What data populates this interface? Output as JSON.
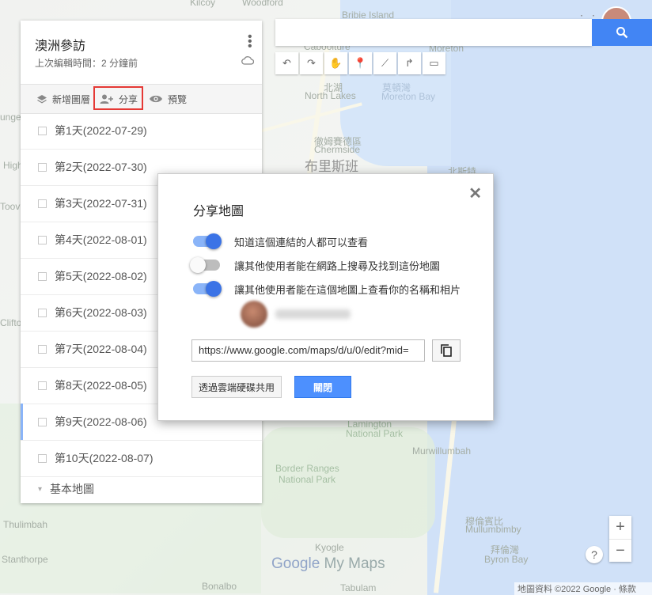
{
  "map": {
    "labels": [
      {
        "text": "Kilcoy",
        "cls": ""
      },
      {
        "text": "Woodford",
        "cls": ""
      },
      {
        "text": "Bribie Island",
        "cls": ""
      },
      {
        "text": "Caboolture",
        "cls": ""
      },
      {
        "text": "Moreton",
        "cls": ""
      },
      {
        "text": "北湖",
        "cls": ""
      },
      {
        "text": "North Lakes",
        "cls": ""
      },
      {
        "text": "莫頓灣",
        "cls": "blue"
      },
      {
        "text": "Moreton Bay",
        "cls": "blue"
      },
      {
        "text": "徹姆賽德區",
        "cls": ""
      },
      {
        "text": "Chermside",
        "cls": ""
      },
      {
        "text": "布里斯班",
        "cls": "big"
      },
      {
        "text": "北斯特",
        "cls": ""
      },
      {
        "text": "unge",
        "cls": ""
      },
      {
        "text": "High",
        "cls": ""
      },
      {
        "text": "Toov",
        "cls": ""
      },
      {
        "text": "Clifto",
        "cls": ""
      },
      {
        "text": "Lamington",
        "cls": "green"
      },
      {
        "text": "National Park",
        "cls": "green"
      },
      {
        "text": "Murwillumbah",
        "cls": ""
      },
      {
        "text": "Border Ranges",
        "cls": "green"
      },
      {
        "text": "National Park",
        "cls": "green"
      },
      {
        "text": "穆倫賓比",
        "cls": ""
      },
      {
        "text": "Mullumbimby",
        "cls": ""
      },
      {
        "text": "拜倫灣",
        "cls": ""
      },
      {
        "text": "Byron Bay",
        "cls": ""
      },
      {
        "text": "Kyogle",
        "cls": ""
      },
      {
        "text": "Thulimbah",
        "cls": ""
      },
      {
        "text": "Stanthorpe",
        "cls": ""
      },
      {
        "text": "Bonalbo",
        "cls": ""
      },
      {
        "text": "Tabulam",
        "cls": ""
      }
    ],
    "logo_google": "Google",
    "logo_mymaps": " My Maps",
    "attribution": "地圖資料 ©2022 Google · 條款",
    "zoom_in": "+",
    "zoom_out": "−",
    "help": "?"
  },
  "panel": {
    "title": "澳洲參訪",
    "subtitle": "上次編輯時間：2 分鐘前",
    "toolbar": {
      "add_layer": "新增圖層",
      "share": "分享",
      "preview": "預覽"
    },
    "layers": [
      {
        "label": "第1天(2022-07-29)"
      },
      {
        "label": "第2天(2022-07-30)"
      },
      {
        "label": "第3天(2022-07-31)"
      },
      {
        "label": "第4天(2022-08-01)"
      },
      {
        "label": "第5天(2022-08-02)"
      },
      {
        "label": "第6天(2022-08-03)"
      },
      {
        "label": "第7天(2022-08-04)"
      },
      {
        "label": "第8天(2022-08-05)"
      },
      {
        "label": "第9天(2022-08-06)"
      },
      {
        "label": "第10天(2022-08-07)"
      }
    ],
    "base_map": "基本地圖"
  },
  "dialog": {
    "title": "分享地圖",
    "options": [
      {
        "label": "知道這個連結的人都可以查看",
        "on": true
      },
      {
        "label": "讓其他使用者能在網路上搜尋及找到這份地圖",
        "on": false
      },
      {
        "label": "讓其他使用者能在這個地圖上查看你的名稱和相片",
        "on": true
      }
    ],
    "link_value": "https://www.google.com/maps/d/u/0/edit?mid=",
    "drive_button": "透過雲端硬碟共用",
    "close_button": "關閉"
  },
  "colors": {
    "accent": "#4285f4",
    "toggle_on": "#3b73e6",
    "highlight": "#e53935"
  }
}
